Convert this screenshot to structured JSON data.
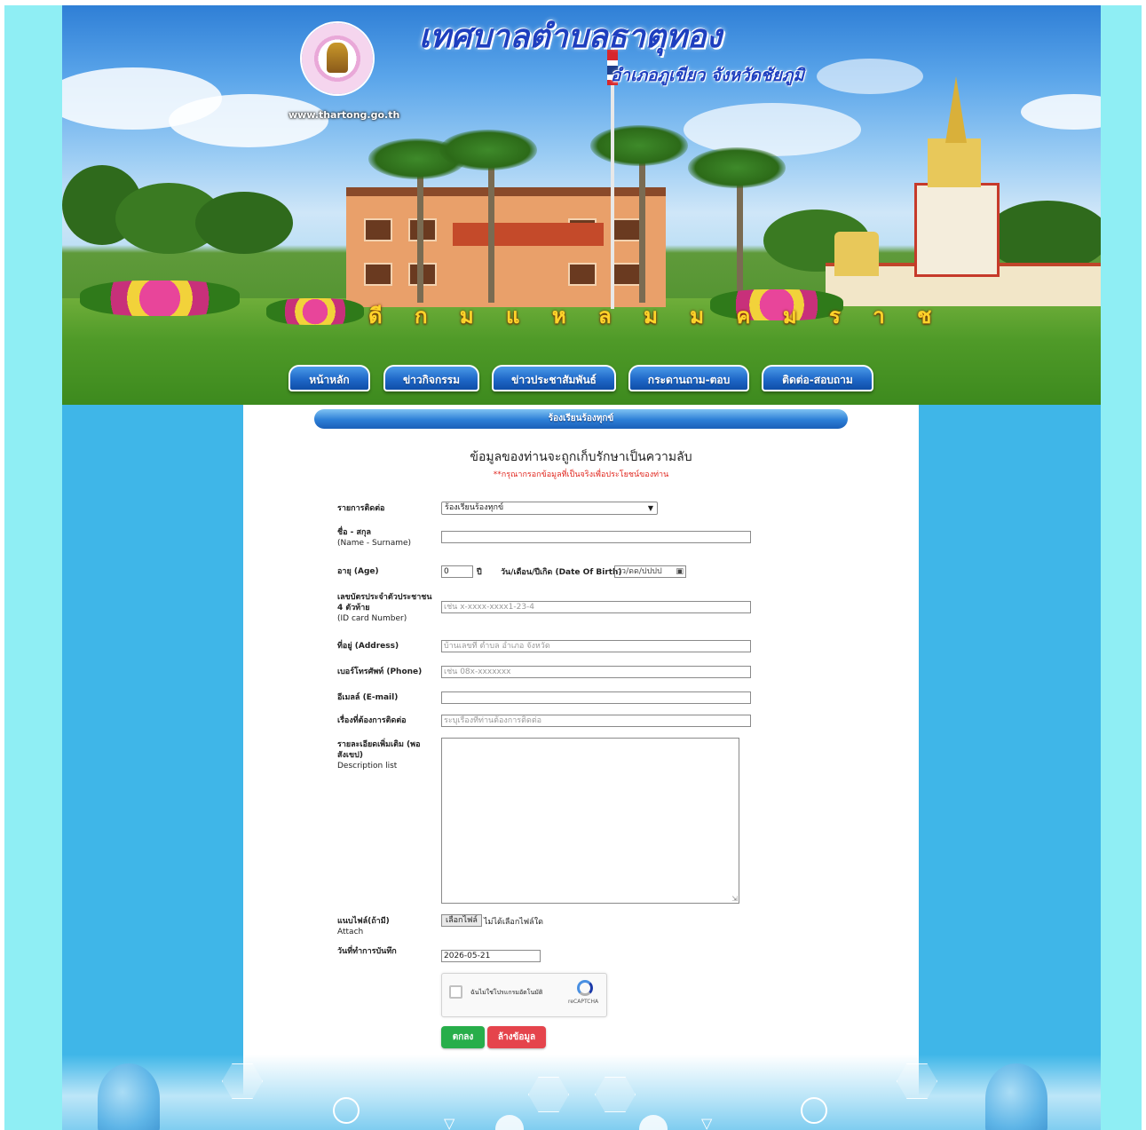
{
  "header": {
    "site_title": "เทศบาลตำบลธาตุทอง",
    "site_subtitle": "อำเภอภูเขียว จังหวัดชัยภูมิ",
    "site_url": "www.thartong.go.th",
    "banner_letters": "ดี ก ม แ ห ล ม ม ค ม ร า ช"
  },
  "nav": {
    "items": [
      {
        "label": "หน้าหลัก"
      },
      {
        "label": "ข่าวกิจกรรม"
      },
      {
        "label": "ข่าวประชาสัมพันธ์"
      },
      {
        "label": "กระดานถาม-ตอบ"
      },
      {
        "label": "ติดต่อ-สอบถาม"
      }
    ]
  },
  "section": {
    "title": "ร้องเรียนร้องทุกข์"
  },
  "form": {
    "heading": "ข้อมูลของท่านจะถูกเก็บรักษาเป็นความลับ",
    "note": "**กรุณากรอกข้อมูลที่เป็นจริงเพื่อประโยชน์ของท่าน",
    "contact_type": {
      "label": "รายการติดต่อ",
      "value": "ร้องเรียนร้องทุกข์"
    },
    "name": {
      "label": "ชื่อ - สกุล",
      "label_en": "(Name - Surname)",
      "value": ""
    },
    "age": {
      "label": "อายุ (Age)",
      "value": "0",
      "unit": "ปี"
    },
    "dob": {
      "label": "วัน/เดือน/ปีเกิด (Date Of Birth)",
      "placeholder": "วว/ดด/ปปปป"
    },
    "id_card": {
      "label": "เลขบัตรประจำตัวประชาชน 4 ตัวท้าย",
      "label_en": "(ID card Number)",
      "placeholder": "เช่น x-xxxx-xxxx1-23-4"
    },
    "address": {
      "label": "ที่อยู่ (Address)",
      "placeholder": "บ้านเลขที่ ตำบล อำเภอ จังหวัด"
    },
    "phone": {
      "label": "เบอร์โทรศัพท์ (Phone)",
      "placeholder": "เช่น 08x-xxxxxxx"
    },
    "email": {
      "label": "อีเมลล์ (E-mail)",
      "value": ""
    },
    "subject": {
      "label": "เรื่องที่ต้องการติดต่อ",
      "placeholder": "ระบุเรื่องที่ท่านต้องการติดต่อ"
    },
    "description": {
      "label": "รายละเอียดเพิ่มเติม (พอสังเขป)",
      "label_en": "Description list",
      "value": ""
    },
    "attach": {
      "label": "แนบไฟล์(ถ้ามี)",
      "label_en": "Attach",
      "button": "เลือกไฟล์",
      "status": "ไม่ได้เลือกไฟล์ใด"
    },
    "record_date": {
      "label": "วันที่ทำการบันทึก",
      "value": "2026-05-21"
    },
    "captcha": {
      "label": "ฉันไม่ใช่โปรแกรมอัตโนมัติ",
      "brand": "reCAPTCHA"
    },
    "submit_label": "ตกลง",
    "clear_label": "ล้างข้อมูล"
  },
  "colors": {
    "page_outer": "#8feef4",
    "page_body": "#3fb6e8",
    "nav_button": "#1f68c8",
    "submit": "#27ae4a",
    "clear": "#e5444c",
    "note": "#e0261e"
  }
}
